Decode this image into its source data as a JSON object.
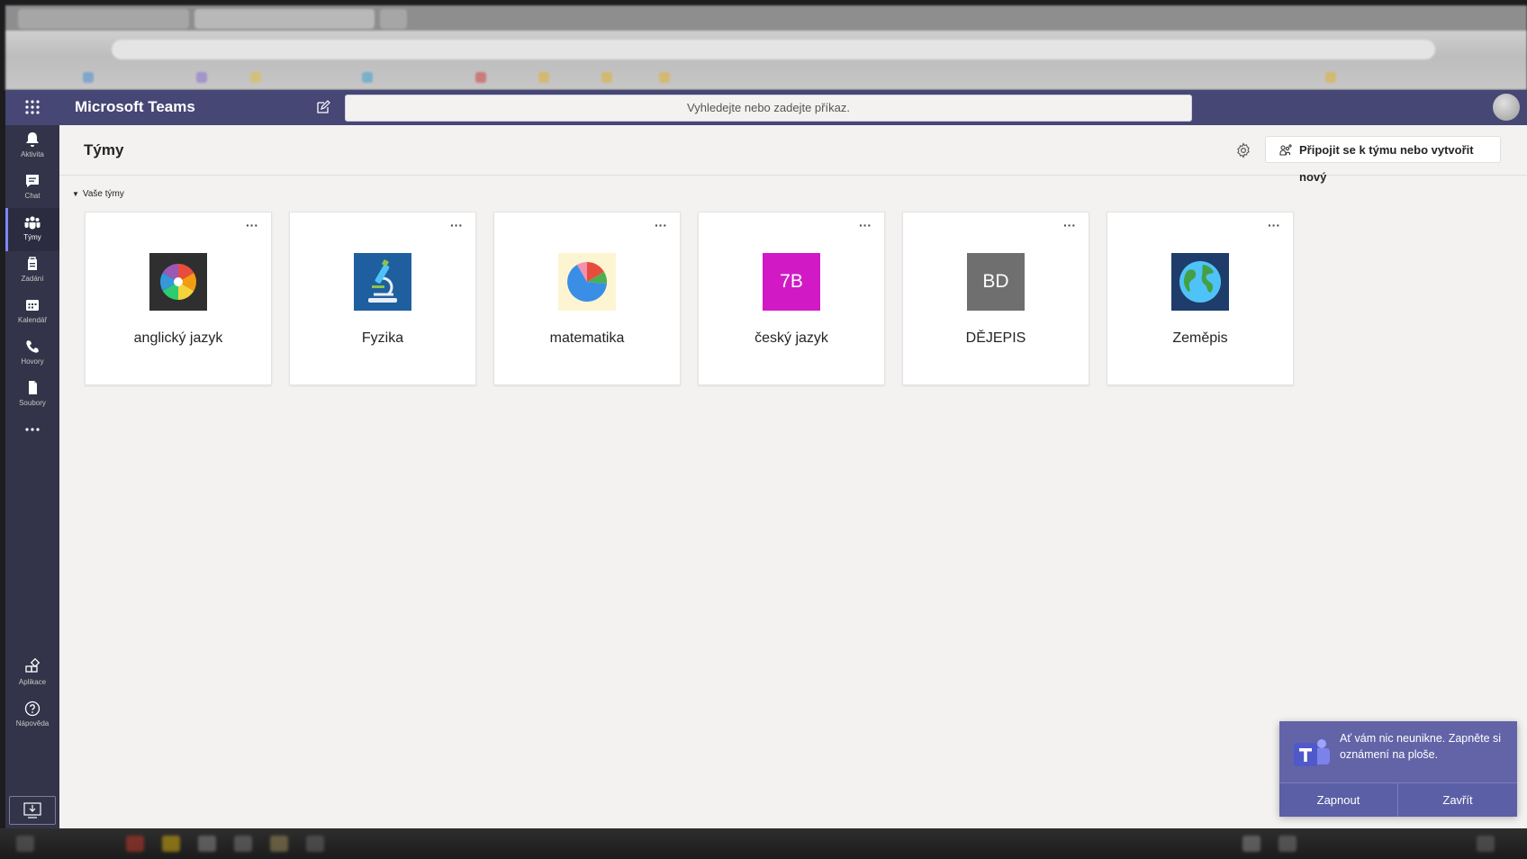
{
  "app": {
    "title": "Microsoft Teams",
    "search_placeholder": "Vyhledejte nebo zadejte příkaz."
  },
  "rail": {
    "items": [
      {
        "label": "Aktivita",
        "icon": "bell-icon"
      },
      {
        "label": "Chat",
        "icon": "chat-icon"
      },
      {
        "label": "Týmy",
        "icon": "teams-icon",
        "active": true
      },
      {
        "label": "Zadání",
        "icon": "assignments-icon"
      },
      {
        "label": "Kalendář",
        "icon": "calendar-icon"
      },
      {
        "label": "Hovory",
        "icon": "phone-icon"
      },
      {
        "label": "Soubory",
        "icon": "files-icon"
      }
    ],
    "more": "...",
    "bottom": [
      {
        "label": "Aplikace",
        "icon": "apps-icon"
      },
      {
        "label": "Nápověda",
        "icon": "help-icon"
      }
    ]
  },
  "page": {
    "title": "Týmy",
    "join_button": "Připojit se k týmu nebo vytvořit nový",
    "section_label": "Vaše týmy"
  },
  "teams": [
    {
      "name": "anglický jazyk",
      "avatar_type": "pie-chart-multicolor",
      "avatar_bg": "#2f2f2f"
    },
    {
      "name": "Fyzika",
      "avatar_type": "microscope",
      "avatar_bg": "#1f5fa0"
    },
    {
      "name": "matematika",
      "avatar_type": "pie-chart",
      "avatar_bg": "#fdf5d2"
    },
    {
      "name": "český jazyk",
      "avatar_text": "7B",
      "avatar_bg": "#d11ac6"
    },
    {
      "name": "DĚJEPIS",
      "avatar_text": "BD",
      "avatar_bg": "#6f6f6f"
    },
    {
      "name": "Zeměpis",
      "avatar_type": "globe",
      "avatar_bg": "#1f3d6b"
    }
  ],
  "card_more": "···",
  "toast": {
    "message": "Ať vám nic neunikne. Zapněte si oznámení na ploše.",
    "primary": "Zapnout",
    "secondary": "Zavřít"
  },
  "colors": {
    "topbar": "#464775",
    "rail": "#33344a",
    "accent": "#6264a7",
    "background": "#f3f2f1"
  }
}
